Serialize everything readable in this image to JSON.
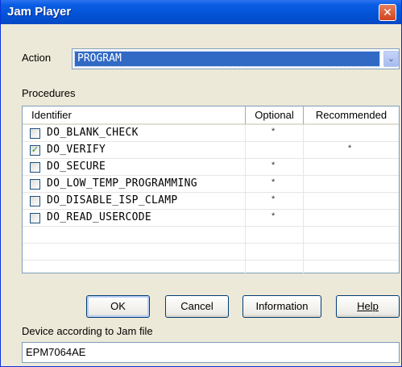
{
  "window": {
    "title": "Jam Player",
    "close_glyph": "✕"
  },
  "action": {
    "label": "Action",
    "selected": "PROGRAM",
    "arrow_glyph": "⌄"
  },
  "procedures": {
    "label": "Procedures",
    "columns": [
      "Identifier",
      "Optional",
      "Recommended"
    ],
    "rows": [
      {
        "id": "DO_BLANK_CHECK",
        "checked": false,
        "optional": "*",
        "recommended": ""
      },
      {
        "id": "DO_VERIFY",
        "checked": true,
        "optional": "",
        "recommended": "*"
      },
      {
        "id": "DO_SECURE",
        "checked": false,
        "optional": "*",
        "recommended": ""
      },
      {
        "id": "DO_LOW_TEMP_PROGRAMMING",
        "checked": false,
        "optional": "*",
        "recommended": ""
      },
      {
        "id": "DO_DISABLE_ISP_CLAMP",
        "checked": false,
        "optional": "*",
        "recommended": ""
      },
      {
        "id": "DO_READ_USERCODE",
        "checked": false,
        "optional": "*",
        "recommended": ""
      }
    ]
  },
  "buttons": {
    "ok": "OK",
    "cancel": "Cancel",
    "information": "Information",
    "help": "Help"
  },
  "device": {
    "label": "Device according to Jam file",
    "value": "EPM7064AE"
  },
  "colors": {
    "title_bar": "#0353d6",
    "selection": "#316ac5",
    "check": "#21a121"
  }
}
